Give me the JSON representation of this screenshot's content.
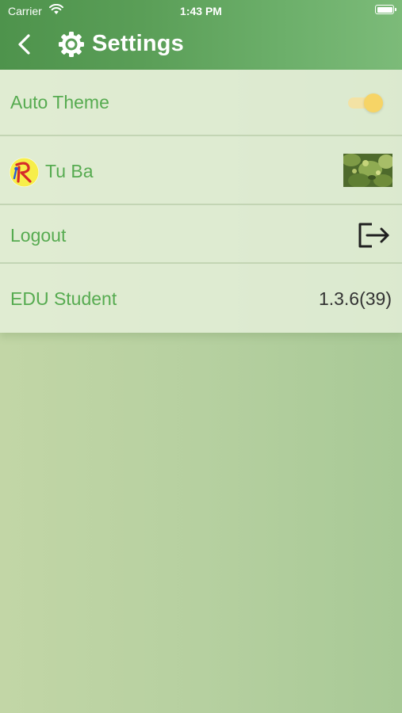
{
  "status_bar": {
    "carrier": "Carrier",
    "time": "1:43 PM"
  },
  "nav": {
    "title": "Settings",
    "back_icon": "chevron-left-icon",
    "title_icon": "gear-icon"
  },
  "settings": {
    "auto_theme": {
      "label": "Auto Theme",
      "enabled": true
    },
    "profile": {
      "name": "Tu Ba"
    },
    "logout": {
      "label": "Logout",
      "icon": "logout-icon"
    },
    "app": {
      "name": "EDU Student",
      "version": "1.3.6(39)"
    }
  },
  "colors": {
    "header": "#5a9e57",
    "label_green": "#56ab50",
    "toggle_knob": "#f6d466"
  }
}
